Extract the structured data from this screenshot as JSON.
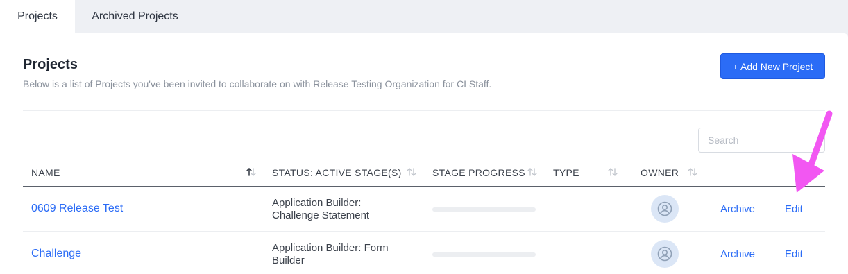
{
  "tabs": [
    {
      "label": "Projects",
      "active": true
    },
    {
      "label": "Archived Projects",
      "active": false
    }
  ],
  "header": {
    "title": "Projects",
    "description": "Below is a list of Projects you've been invited to collaborate on with Release Testing Organization for CI Staff.",
    "add_button_label": "+ Add New Project"
  },
  "search": {
    "placeholder": "Search",
    "value": ""
  },
  "table": {
    "columns": [
      {
        "label": "NAME",
        "sort_icon": "sort-ascending-icon"
      },
      {
        "label": "STATUS: ACTIVE STAGE(S)",
        "sort_icon": "sort-icon"
      },
      {
        "label": "STAGE PROGRESS",
        "sort_icon": "sort-icon"
      },
      {
        "label": "TYPE",
        "sort_icon": "sort-icon"
      },
      {
        "label": "OWNER",
        "sort_icon": "sort-icon"
      }
    ],
    "rows": [
      {
        "name": "0609 Release Test",
        "status": "Application Builder: Challenge Statement",
        "progress": 0,
        "type": "",
        "owner_icon": "user-avatar-icon",
        "archive_label": "Archive",
        "edit_label": "Edit"
      },
      {
        "name": "Challenge",
        "status": "Application Builder: Form Builder",
        "progress": 0,
        "type": "",
        "owner_icon": "user-avatar-icon",
        "archive_label": "Archive",
        "edit_label": "Edit"
      }
    ]
  },
  "colors": {
    "accent": "#2b6cf6",
    "annotation_arrow": "#f257f2",
    "page_background": "#eef0f4"
  }
}
